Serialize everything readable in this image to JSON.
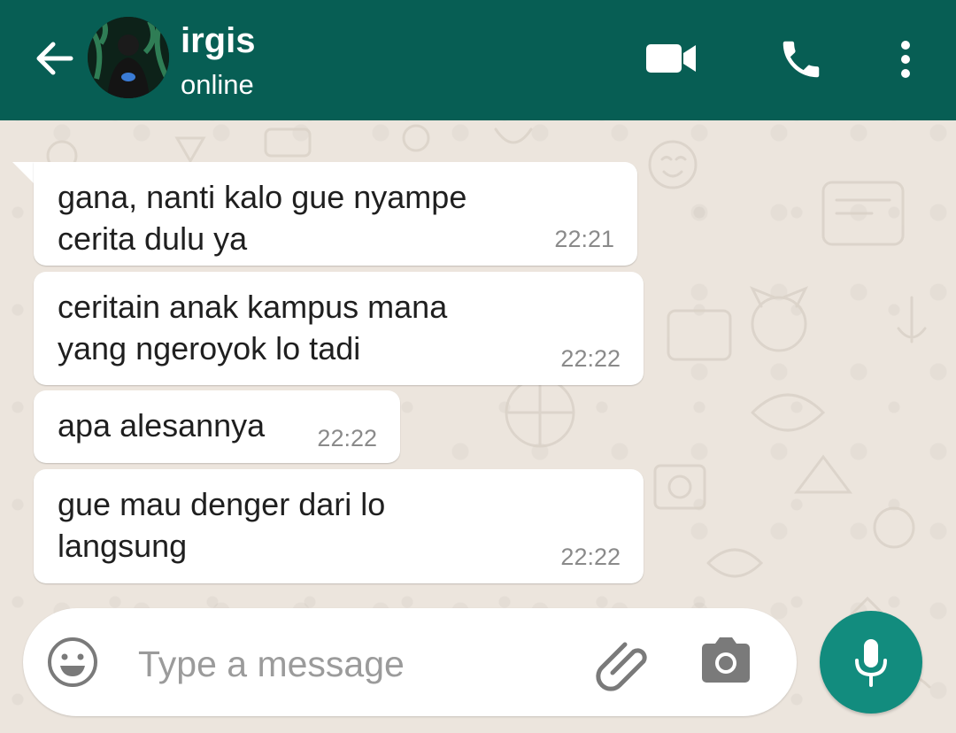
{
  "header": {
    "contact_name": "irgis",
    "status": "online",
    "icons": [
      "back-arrow-icon",
      "avatar",
      "video-call-icon",
      "phone-icon",
      "more-vert-icon"
    ]
  },
  "messages": [
    {
      "text": "gana, nanti kalo gue nyampe\ncerita dulu ya",
      "time": "22:21"
    },
    {
      "text": "ceritain anak kampus mana\nyang ngeroyok lo tadi",
      "time": "22:22"
    },
    {
      "text": "apa alesannya",
      "time": "22:22"
    },
    {
      "text": "gue mau denger dari lo\nlangsung",
      "time": "22:22"
    }
  ],
  "composer": {
    "placeholder": "Type a message",
    "value": "",
    "icons": [
      "emoji-icon",
      "attach-icon",
      "camera-icon",
      "mic-icon"
    ]
  },
  "colors": {
    "header": "#075e54",
    "mic_button": "#128c7e",
    "chat_background": "#ece5dd",
    "bubble": "#ffffff"
  }
}
